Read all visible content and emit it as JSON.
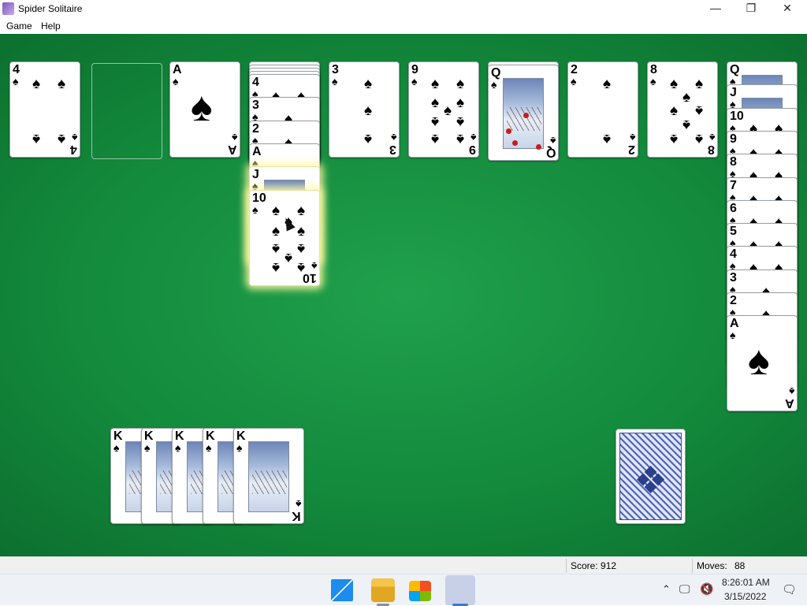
{
  "window": {
    "title": "Spider Solitaire",
    "min_icon": "minimize-icon",
    "max_icon": "restore-icon",
    "close_icon": "close-icon"
  },
  "menu": [
    {
      "label": "Game"
    },
    {
      "label": "Help"
    }
  ],
  "suit_symbol": "♠",
  "tableau": [
    {
      "hidden": 0,
      "cards": [
        "4"
      ]
    },
    {
      "hidden": 0,
      "cards": []
    },
    {
      "hidden": 0,
      "cards": [
        "A"
      ]
    },
    {
      "hidden": 4,
      "cards": [
        "4",
        "3",
        "2",
        "A",
        "J",
        "10"
      ],
      "highlight_from": 4
    },
    {
      "hidden": 0,
      "cards": [
        "3"
      ]
    },
    {
      "hidden": 0,
      "cards": [
        "9"
      ]
    },
    {
      "hidden": 1,
      "cards": [
        "Q"
      ]
    },
    {
      "hidden": 0,
      "cards": [
        "2"
      ]
    },
    {
      "hidden": 0,
      "cards": [
        "8"
      ]
    },
    {
      "hidden": 0,
      "cards": [
        "Q",
        "J",
        "10",
        "9",
        "8",
        "7",
        "6",
        "5",
        "4",
        "3",
        "2",
        "A"
      ]
    }
  ],
  "completed": [
    "K",
    "K",
    "K",
    "K",
    "K"
  ],
  "stock_icon": "card-back-icon",
  "status": {
    "score_label": "Score: 912",
    "moves_label": "Moves:",
    "moves_value": "88"
  },
  "taskbar": {
    "icons": [
      "windows-start-icon",
      "file-explorer-icon",
      "microsoft-store-icon",
      "spider-solitaire-icon"
    ],
    "time": "8:26:01 AM",
    "date": "3/15/2022"
  },
  "colors": {
    "felt": "#138a3c",
    "card_back": "#4e63b5"
  }
}
